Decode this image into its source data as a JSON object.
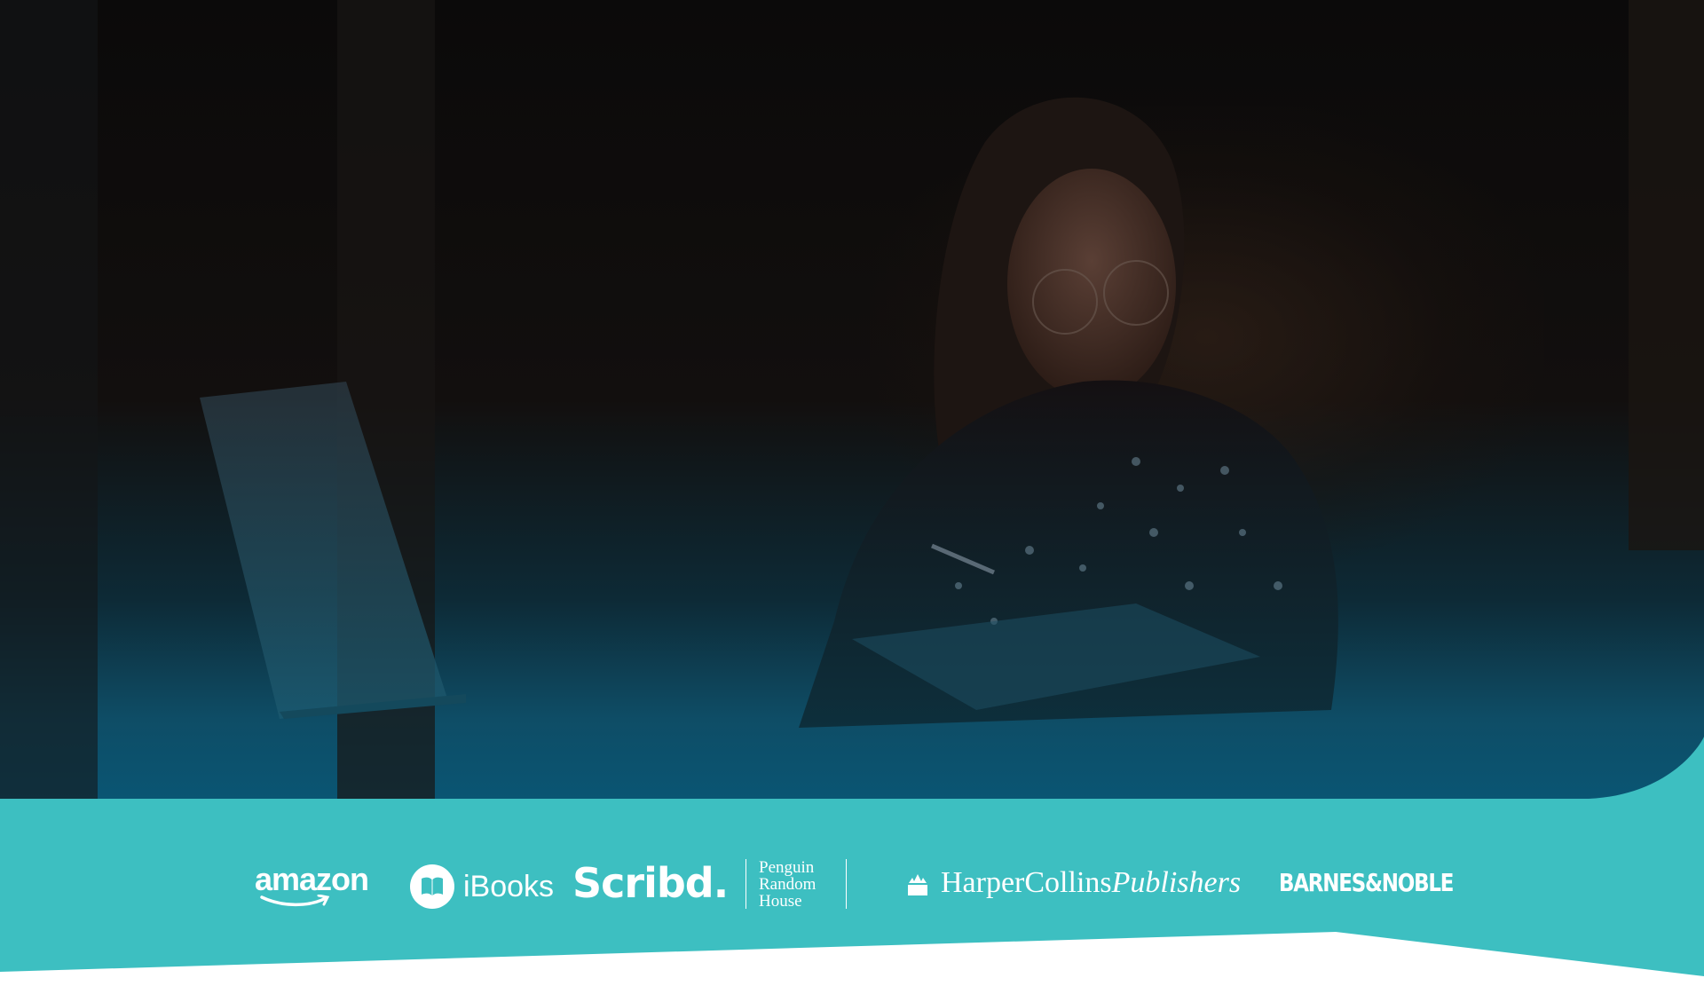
{
  "hero": {
    "image": "woman-writing-at-desk-photo",
    "overlay_colors": [
      "#0b0a0a",
      "#0a5573"
    ]
  },
  "partner_band": {
    "background": "#3dbfc1",
    "logos": [
      {
        "name": "amazon",
        "text": "amazon"
      },
      {
        "name": "ibooks",
        "text": "iBooks",
        "icon": "open-book-icon"
      },
      {
        "name": "scribd",
        "text": "Scribd."
      },
      {
        "name": "penguin-random-house",
        "lines": [
          "Penguin",
          "Random",
          "House"
        ]
      },
      {
        "name": "harpercollins",
        "text": "HarperCollins",
        "text_italic": "Publishers",
        "icon": "fire-building-icon"
      },
      {
        "name": "barnes-noble",
        "text": "BARNES&NOBLE"
      }
    ]
  }
}
